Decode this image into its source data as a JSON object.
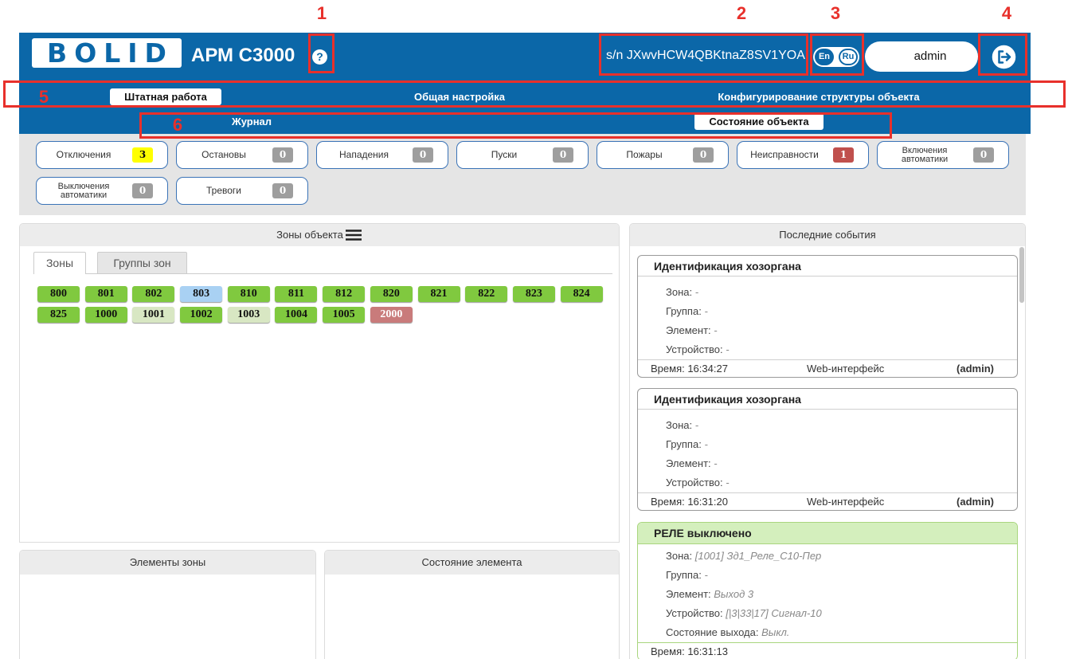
{
  "annotations": {
    "markers": [
      "1",
      "2",
      "3",
      "4",
      "5",
      "6"
    ]
  },
  "colors": {
    "brand": "#0b67a8",
    "annotation": "#e8302b",
    "panel_gray": "#e5e5e5",
    "counter_border": "#3a73b7",
    "zone_green": "#80c93f",
    "zone_blue": "#a9d1f3",
    "zone_light_green": "#d8e7c3",
    "zone_red": "#c97b7b",
    "badge_gray": "#9e9e9e",
    "badge_yellow": "#ffff00",
    "badge_red": "#c0504d",
    "event_ok_bg": "#d4efbd",
    "event_ok_border": "#a9d67e"
  },
  "header": {
    "logo_text": "BOLID",
    "app_title": "АРМ С3000",
    "help_icon": "question-circle-icon",
    "serial": "s/n JXwvHCW4QBKtnaZ8SV1YOA",
    "lang": {
      "en": "En",
      "ru": "Ru"
    },
    "user": "admin",
    "logout_icon": "logout-icon"
  },
  "nav": {
    "primary": [
      {
        "label": "Штатная работа",
        "active": true
      },
      {
        "label": "Общая настройка",
        "active": false
      },
      {
        "label": "Конфигурирование структуры объекта",
        "active": false
      }
    ],
    "secondary": [
      {
        "label": "Журнал",
        "active": false
      },
      {
        "label": "Состояние объекта",
        "active": true
      }
    ]
  },
  "counters": [
    {
      "label": "Отключения",
      "count": "3",
      "status": "yellow"
    },
    {
      "label": "Остановы",
      "count": "0",
      "status": "gray"
    },
    {
      "label": "Нападения",
      "count": "0",
      "status": "gray"
    },
    {
      "label": "Пуски",
      "count": "0",
      "status": "gray"
    },
    {
      "label": "Пожары",
      "count": "0",
      "status": "gray"
    },
    {
      "label": "Неисправности",
      "count": "1",
      "status": "red"
    },
    {
      "label": "Включения автоматики",
      "count": "0",
      "status": "gray"
    },
    {
      "label": "Выключения автоматики",
      "count": "0",
      "status": "gray"
    },
    {
      "label": "Тревоги",
      "count": "0",
      "status": "gray"
    }
  ],
  "zones_panel": {
    "title": "Зоны объекта",
    "menu_icon": "hamburger-menu-icon",
    "tabs": [
      {
        "label": "Зоны",
        "active": true
      },
      {
        "label": "Группы зон",
        "active": false
      }
    ],
    "zones": [
      {
        "number": "800",
        "state": "green"
      },
      {
        "number": "801",
        "state": "green"
      },
      {
        "number": "802",
        "state": "green"
      },
      {
        "number": "803",
        "state": "blue"
      },
      {
        "number": "810",
        "state": "green"
      },
      {
        "number": "811",
        "state": "green"
      },
      {
        "number": "812",
        "state": "green"
      },
      {
        "number": "820",
        "state": "green"
      },
      {
        "number": "821",
        "state": "green"
      },
      {
        "number": "822",
        "state": "green"
      },
      {
        "number": "823",
        "state": "green"
      },
      {
        "number": "824",
        "state": "green"
      },
      {
        "number": "825",
        "state": "green"
      },
      {
        "number": "1000",
        "state": "green"
      },
      {
        "number": "1001",
        "state": "light-green"
      },
      {
        "number": "1002",
        "state": "green"
      },
      {
        "number": "1003",
        "state": "light-green"
      },
      {
        "number": "1004",
        "state": "green"
      },
      {
        "number": "1005",
        "state": "green"
      },
      {
        "number": "2000",
        "state": "red"
      }
    ]
  },
  "zone_elements_panel": {
    "title": "Элементы зоны"
  },
  "element_state_panel": {
    "title": "Состояние элемента"
  },
  "events": {
    "title": "Последние события",
    "items": [
      {
        "title": "Идентификация хозоргана",
        "style": "default",
        "fields": [
          {
            "label": "Зона:",
            "value": "-"
          },
          {
            "label": "Группа:",
            "value": "-"
          },
          {
            "label": "Элемент:",
            "value": "-"
          },
          {
            "label": "Устройство:",
            "value": "-"
          }
        ],
        "time": "Время: 16:34:27",
        "source": "Web-интерфейс",
        "user": "(admin)"
      },
      {
        "title": "Идентификация хозоргана",
        "style": "default",
        "fields": [
          {
            "label": "Зона:",
            "value": "-"
          },
          {
            "label": "Группа:",
            "value": "-"
          },
          {
            "label": "Элемент:",
            "value": "-"
          },
          {
            "label": "Устройство:",
            "value": "-"
          }
        ],
        "time": "Время: 16:31:20",
        "source": "Web-интерфейс",
        "user": "(admin)"
      },
      {
        "title": "РЕЛЕ выключено",
        "style": "ok",
        "fields": [
          {
            "label": "Зона:",
            "value": "[1001] Зд1_Реле_С10-Пер"
          },
          {
            "label": "Группа:",
            "value": "-"
          },
          {
            "label": "Элемент:",
            "value": "Выход 3"
          },
          {
            "label": "Устройство:",
            "value": "[|3|33|17] Сигнал-10"
          },
          {
            "label": "Состояние выхода:",
            "value": "Выкл."
          }
        ],
        "time": "Время: 16:31:13"
      }
    ]
  }
}
